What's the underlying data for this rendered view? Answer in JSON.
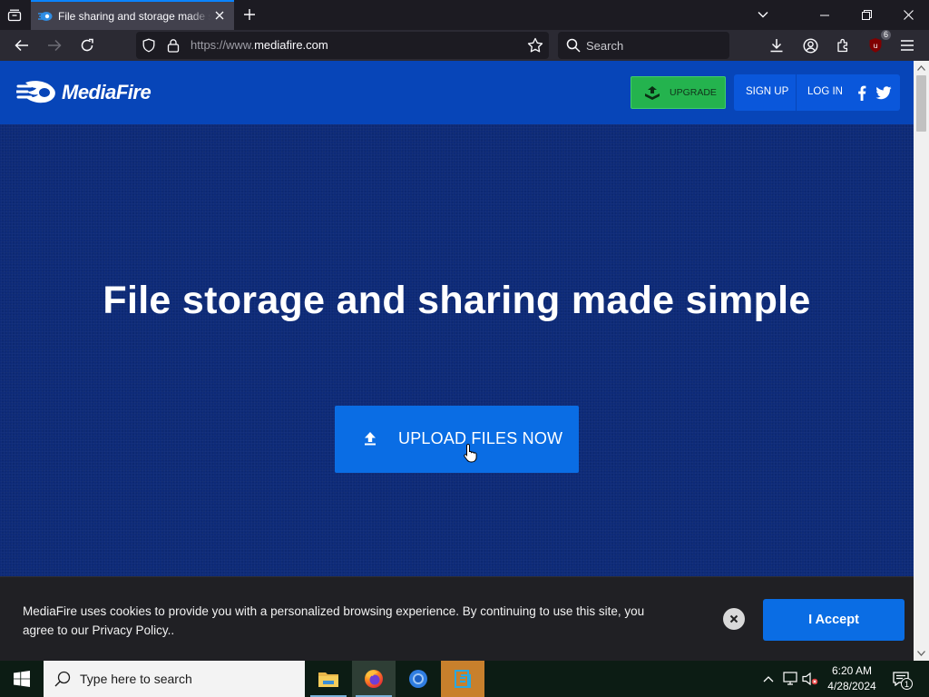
{
  "browser": {
    "tab_title": "File sharing and storage made simple",
    "url_prefix": "https://www.",
    "url_domain": "mediafire.com",
    "search_placeholder": "Search",
    "extension_badge": "6"
  },
  "site": {
    "logo_text": "MediaFire",
    "upgrade_label": "UPGRADE",
    "sign_up_label": "SIGN UP",
    "log_in_label": "LOG IN",
    "hero_title": "File storage and sharing made simple",
    "upload_label": "UPLOAD FILES NOW"
  },
  "cookie_bar": {
    "message": "MediaFire uses cookies to provide you with a personalized browsing experience. By continuing to use this site, you agree to our Privacy Policy..",
    "accept_label": "I Accept"
  },
  "taskbar": {
    "search_placeholder": "Type here to search",
    "time": "6:20 AM",
    "date": "4/28/2024",
    "notification_count": "1"
  },
  "colors": {
    "site_header": "#0745b8",
    "hero_background": "#0d2a78",
    "primary_button": "#0a6de4",
    "upgrade_button": "#24b34e",
    "cookie_bar": "#202024"
  },
  "icons": [
    "tab-list-icon",
    "mediafire-favicon",
    "close-icon",
    "plus-icon",
    "chevron-down-icon",
    "minimize-icon",
    "restore-icon",
    "back-arrow-icon",
    "forward-arrow-icon",
    "reload-icon",
    "shield-icon",
    "lock-icon",
    "bookmark-star-icon",
    "search-icon",
    "download-icon",
    "account-icon",
    "extensions-icon",
    "ublock-icon",
    "hamburger-menu-icon",
    "mediafire-flame-icon",
    "upgrade-box-icon",
    "facebook-icon",
    "twitter-icon",
    "upload-arrow-icon",
    "hand-cursor-icon",
    "windows-logo-icon",
    "file-explorer-icon",
    "firefox-icon",
    "chrome-icon",
    "app-icon",
    "chevron-up-icon",
    "network-icon",
    "speaker-muted-icon",
    "notification-icon"
  ]
}
